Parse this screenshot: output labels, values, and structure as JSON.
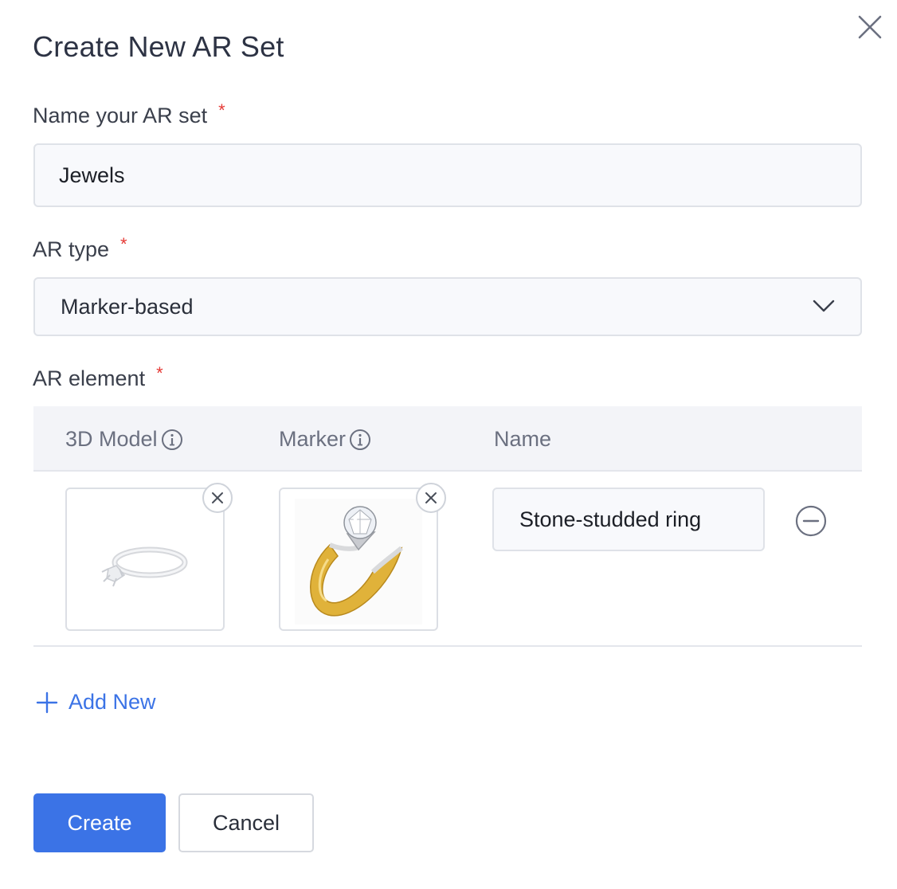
{
  "dialog": {
    "title": "Create New AR Set"
  },
  "form": {
    "name_label": "Name your AR set",
    "name_value": "Jewels",
    "required_mark": "*",
    "type_label": "AR type",
    "type_value": "Marker-based",
    "element_label": "AR element"
  },
  "table": {
    "columns": [
      "3D Model",
      "Marker",
      "Name"
    ],
    "rows": [
      {
        "name": "Stone-studded ring"
      }
    ]
  },
  "actions": {
    "add_new": "Add New",
    "create": "Create",
    "cancel": "Cancel"
  },
  "colors": {
    "primary": "#3b73e6",
    "required": "#e53935",
    "ring_gold": "#e0b23a"
  }
}
